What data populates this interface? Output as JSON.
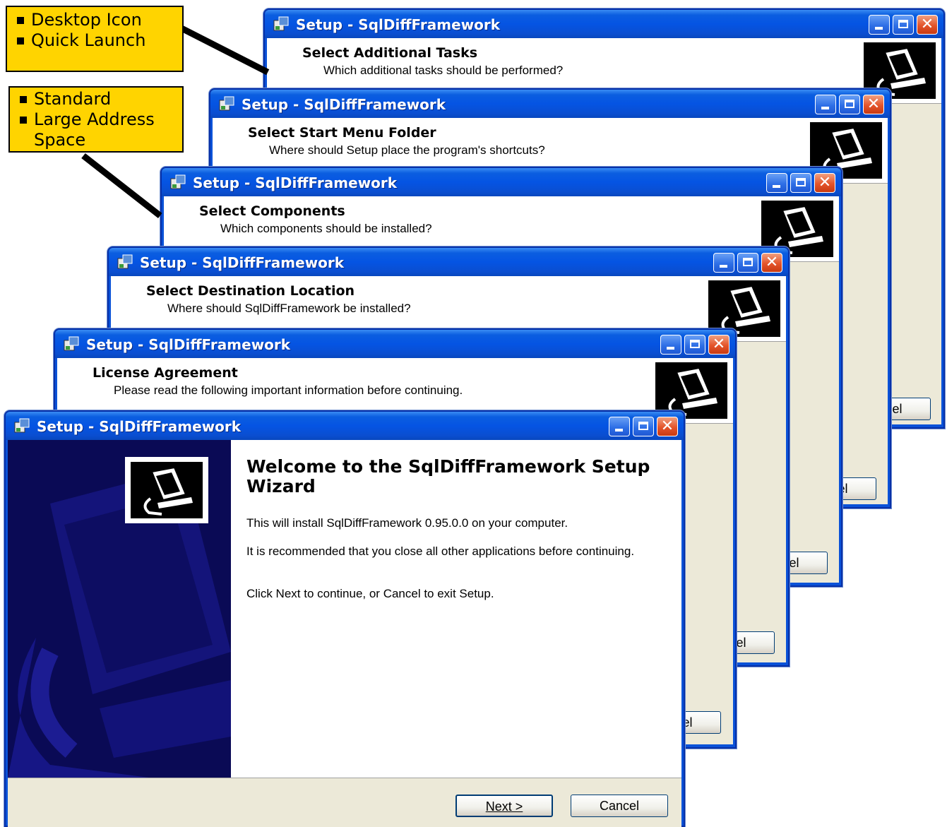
{
  "window_title": "Setup - SqlDiffFramework",
  "pages": {
    "additional_tasks": {
      "title": "Select Additional Tasks",
      "subtitle": "Which additional tasks should be performed?"
    },
    "start_menu": {
      "title": "Select Start Menu Folder",
      "subtitle": "Where should Setup place the program's shortcuts?"
    },
    "components": {
      "title": "Select Components",
      "subtitle": "Which components should be installed?"
    },
    "destination": {
      "title": "Select Destination Location",
      "subtitle": "Where should SqlDiffFramework be installed?"
    },
    "license": {
      "title": "License Agreement",
      "subtitle": "Please read the following important information before continuing."
    }
  },
  "welcome": {
    "heading": "Welcome to the SqlDiffFramework Setup Wizard",
    "p1": "This will install SqlDiffFramework 0.95.0.0 on your computer.",
    "p2": "It is recommended that you close all other applications before continuing.",
    "p3": "Click Next to continue, or Cancel to exit Setup.",
    "next_label": "Next >",
    "cancel_label": "Cancel"
  },
  "partial_cancel_label": "el",
  "callouts": {
    "tasks": [
      "Desktop Icon",
      "Quick Launch"
    ],
    "components": [
      "Standard",
      "Large Address Space"
    ]
  },
  "colors": {
    "titlebar": "#0554e3",
    "callout": "#ffd400",
    "wizard_panel": "#0a0a55"
  }
}
